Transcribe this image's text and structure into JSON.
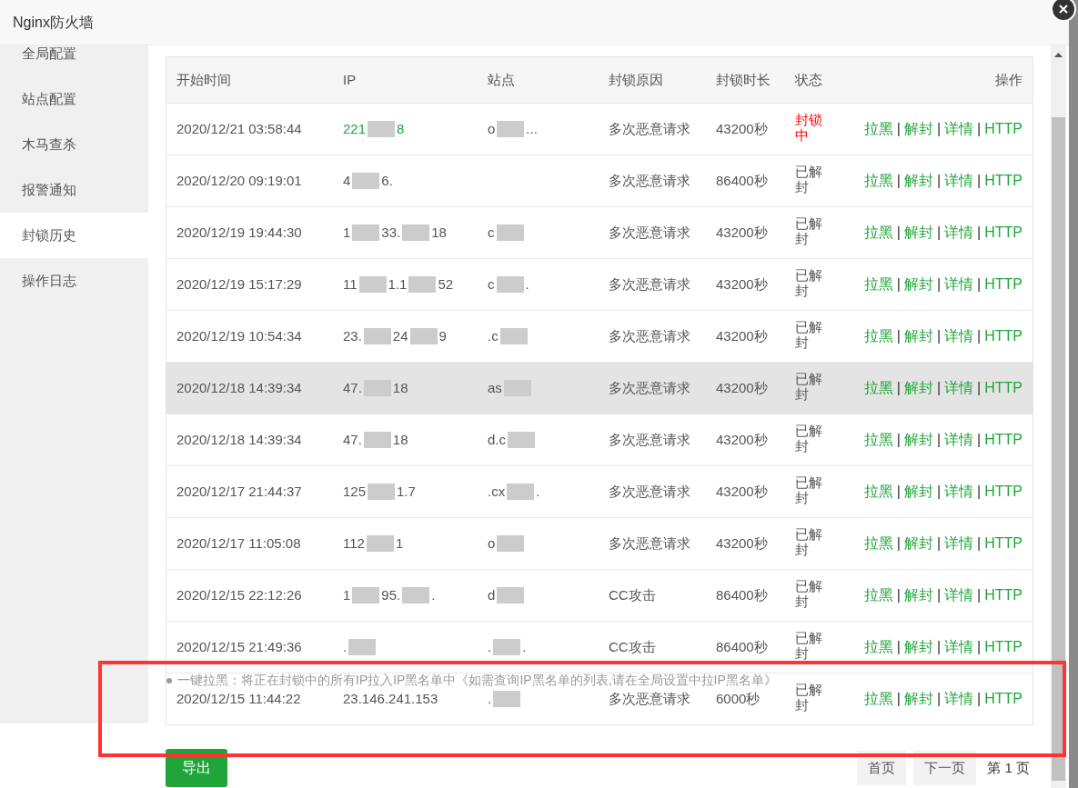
{
  "window": {
    "title": "Nginx防火墙"
  },
  "sidebar": {
    "items": [
      {
        "label": "全局配置",
        "selected": false
      },
      {
        "label": "站点配置",
        "selected": false
      },
      {
        "label": "木马查杀",
        "selected": false
      },
      {
        "label": "报警通知",
        "selected": false
      },
      {
        "label": "封锁历史",
        "selected": true
      },
      {
        "label": "操作日志",
        "selected": false
      }
    ]
  },
  "table": {
    "columns": [
      "开始时间",
      "IP",
      "站点",
      "封锁原因",
      "封锁时长",
      "状态",
      "操作"
    ],
    "rows": [
      {
        "time": "2020/12/21 03:58:44",
        "ip": [
          "221",
          "8"
        ],
        "site": [
          "o",
          "..."
        ],
        "reason": "多次恶意请求",
        "duration": "43200秒",
        "status": "封锁中",
        "blocked": true,
        "selected": false,
        "actions": [
          "拉黑",
          "解封",
          "详情",
          "HTTP"
        ],
        "separators": [
          "|",
          "|",
          "|"
        ]
      },
      {
        "time": "2020/12/20 09:19:01",
        "ip": [
          "4",
          "6."
        ],
        "site": [],
        "reason": "多次恶意请求",
        "duration": "86400秒",
        "status": "已解封",
        "blocked": false,
        "selected": false,
        "actions": [
          "拉黑",
          "解封",
          "详情",
          "HTTP"
        ],
        "separators": [
          "|",
          "|",
          "|"
        ]
      },
      {
        "time": "2020/12/19 19:44:30",
        "ip": [
          "1",
          "33.",
          "18"
        ],
        "site": [
          "c"
        ],
        "reason": "多次恶意请求",
        "duration": "43200秒",
        "status": "已解封",
        "blocked": false,
        "selected": false,
        "actions": [
          "拉黑",
          "解封",
          "详情",
          "HTTP"
        ],
        "separators": [
          "|",
          "|",
          "|"
        ]
      },
      {
        "time": "2020/12/19 15:17:29",
        "ip": [
          "11",
          "1.1",
          "52"
        ],
        "site": [
          "c",
          "."
        ],
        "reason": "多次恶意请求",
        "duration": "43200秒",
        "status": "已解封",
        "blocked": false,
        "selected": false,
        "actions": [
          "拉黑",
          "解封",
          "详情",
          "HTTP"
        ],
        "separators": [
          "|",
          "|",
          "|"
        ]
      },
      {
        "time": "2020/12/19 10:54:34",
        "ip": [
          "23.",
          "24",
          "9"
        ],
        "site": [
          ".c"
        ],
        "reason": "多次恶意请求",
        "duration": "43200秒",
        "status": "已解封",
        "blocked": false,
        "selected": false,
        "actions": [
          "拉黑",
          "解封",
          "详情",
          "HTTP"
        ],
        "separators": [
          "|",
          "|",
          "|"
        ]
      },
      {
        "time": "2020/12/18 14:39:34",
        "ip": [
          "47.",
          "18"
        ],
        "site": [
          "as"
        ],
        "reason": "多次恶意请求",
        "duration": "43200秒",
        "status": "已解封",
        "blocked": false,
        "selected": true,
        "actions": [
          "拉黑",
          "解封",
          "详情",
          "HTTP"
        ],
        "separators": [
          "|",
          "|",
          "|"
        ]
      },
      {
        "time": "2020/12/18 14:39:34",
        "ip": [
          "47.",
          "18"
        ],
        "site": [
          "d.c"
        ],
        "reason": "多次恶意请求",
        "duration": "43200秒",
        "status": "已解封",
        "blocked": false,
        "selected": false,
        "actions": [
          "拉黑",
          "解封",
          "详情",
          "HTTP"
        ],
        "separators": [
          "|",
          "|",
          "|"
        ]
      },
      {
        "time": "2020/12/17 21:44:37",
        "ip": [
          "125",
          "1.7"
        ],
        "site": [
          ".cx",
          "."
        ],
        "reason": "多次恶意请求",
        "duration": "43200秒",
        "status": "已解封",
        "blocked": false,
        "selected": false,
        "actions": [
          "拉黑",
          "解封",
          "详情",
          "HTTP"
        ],
        "separators": [
          "|",
          "|",
          "|"
        ]
      },
      {
        "time": "2020/12/17 11:05:08",
        "ip": [
          "112",
          "1"
        ],
        "site": [
          "o"
        ],
        "reason": "多次恶意请求",
        "duration": "43200秒",
        "status": "已解封",
        "blocked": false,
        "selected": false,
        "actions": [
          "拉黑",
          "解封",
          "详情",
          "HTTP"
        ],
        "separators": [
          "|",
          "|",
          "|"
        ]
      },
      {
        "time": "2020/12/15 22:12:26",
        "ip": [
          "1",
          "95.",
          "."
        ],
        "site": [
          "d"
        ],
        "reason": "CC攻击",
        "duration": "86400秒",
        "status": "已解封",
        "blocked": false,
        "selected": false,
        "actions": [
          "拉黑",
          "解封",
          "详情",
          "HTTP"
        ],
        "separators": [
          "|",
          "|",
          "|"
        ]
      },
      {
        "time": "2020/12/15 21:49:36",
        "ip": [
          "."
        ],
        "site": [
          ".",
          "."
        ],
        "reason": "CC攻击",
        "duration": "86400秒",
        "status": "已解封",
        "blocked": false,
        "selected": false,
        "actions": [
          "拉黑",
          "解封",
          "详情",
          "HTTP"
        ],
        "separators": [
          "|",
          "|",
          "|"
        ]
      },
      {
        "time": "2020/12/15 11:44:22",
        "ip": [
          "23.146.241.153"
        ],
        "site": [
          "."
        ],
        "reason": "多次恶意请求",
        "duration": "6000秒",
        "status": "已解封",
        "blocked": false,
        "selected": false,
        "actions": [
          "拉黑",
          "解封",
          "详情",
          "HTTP"
        ],
        "separators": [
          "|",
          "|",
          "|"
        ]
      }
    ]
  },
  "note": "一键拉黑：将正在封锁中的所有IP拉入IP黑名单中《如需查询IP黑名单的列表,请在全局设置中拉IP黑名单》",
  "export_button": "导出",
  "pagination": {
    "first": "首页",
    "next": "下一页",
    "current": "第 1 页"
  }
}
